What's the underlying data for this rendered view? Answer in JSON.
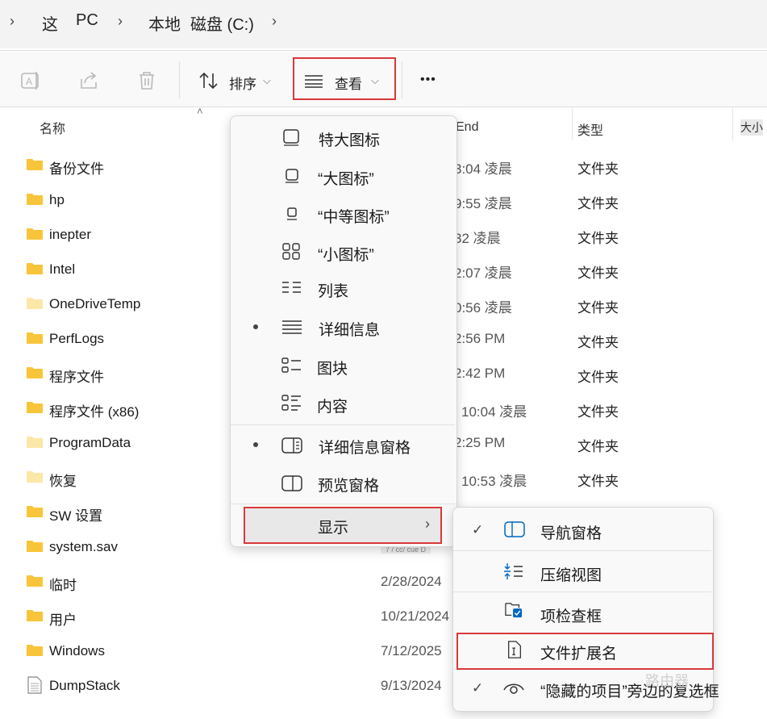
{
  "breadcrumb": {
    "items": [
      "这",
      "PC",
      "本地",
      "磁盘 (C:)"
    ]
  },
  "toolbar": {
    "sort_label": "排序",
    "view_label": "查看",
    "more_label": "•••"
  },
  "file_list": {
    "headers": {
      "name": "名称",
      "date": "End",
      "type": "类型",
      "size": "大小"
    },
    "rows": [
      {
        "name": "备份文件",
        "date": "3:04 凌晨",
        "type": "文件夹"
      },
      {
        "name": "hp",
        "date": "9:55 凌晨",
        "type": "文件夹"
      },
      {
        "name": "inepter",
        "date": "32 凌晨",
        "type": "文件夹"
      },
      {
        "name": "Intel",
        "date": "2:07 凌晨",
        "type": "文件夹"
      },
      {
        "name": "OneDriveTemp",
        "date": "0:56 凌晨",
        "type": "文件夹"
      },
      {
        "name": "PerfLogs",
        "date": "2:56 PM",
        "type": "文件夹"
      },
      {
        "name": "程序文件",
        "date": "2:42 PM",
        "type": "文件夹"
      },
      {
        "name": "程序文件 (x86)",
        "date": "10:04 凌晨",
        "type": "文件夹"
      },
      {
        "name": "ProgramData",
        "date": "2:25 PM",
        "type": "文件夹"
      },
      {
        "name": "恢复",
        "date": "10:53 凌晨",
        "type": "文件夹"
      },
      {
        "name": "SW 设置",
        "date": "",
        "type": ""
      },
      {
        "name": "system.sav",
        "date": "7 / cc/ cue D",
        "type": ""
      },
      {
        "name": "临时",
        "date": "2/28/2024",
        "type": ""
      },
      {
        "name": "用户",
        "date": "10/21/2024",
        "type": ""
      },
      {
        "name": "Windows",
        "date": "7/12/2025",
        "type": ""
      },
      {
        "name": "DumpStack",
        "date": "9/13/2024",
        "type": ""
      }
    ]
  },
  "view_menu": {
    "items": [
      {
        "label": "特大图标"
      },
      {
        "label": "“大图标”"
      },
      {
        "label": "“中等图标”"
      },
      {
        "label": "“小图标”"
      },
      {
        "label": "列表"
      },
      {
        "label": "详细信息"
      },
      {
        "label": "图块"
      },
      {
        "label": "内容"
      },
      {
        "label": "详细信息窗格"
      },
      {
        "label": "预览窗格"
      },
      {
        "label": "显示"
      }
    ]
  },
  "show_submenu": {
    "items": [
      {
        "label": "导航窗格"
      },
      {
        "label": "压缩视图"
      },
      {
        "label": "项检查框"
      },
      {
        "label": "文件扩展名"
      },
      {
        "label": "“隐藏的项目”旁边的复选框"
      }
    ]
  },
  "colors": {
    "highlight": "#d9383a",
    "accent": "#0067c0",
    "folder": "#f8c53a"
  },
  "watermark": "路由器"
}
